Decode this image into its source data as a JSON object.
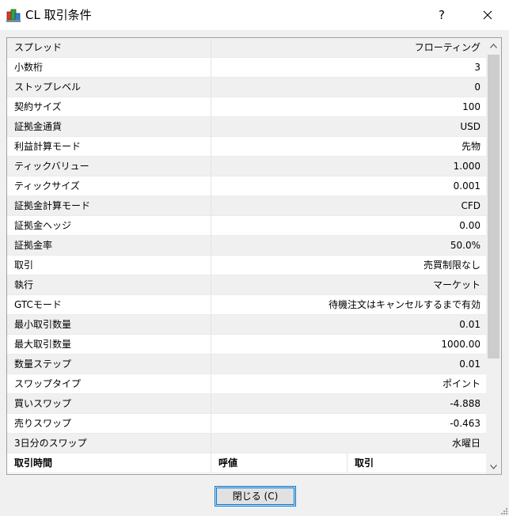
{
  "window": {
    "title": "CL 取引条件",
    "help_label": "?",
    "icon": "app-terminal-icon"
  },
  "spec_rows": [
    {
      "key": "スプレッド",
      "value": "フローティング"
    },
    {
      "key": "小数桁",
      "value": "3"
    },
    {
      "key": "ストップレベル",
      "value": "0"
    },
    {
      "key": "契約サイズ",
      "value": "100"
    },
    {
      "key": "証拠金通貨",
      "value": "USD"
    },
    {
      "key": "利益計算モード",
      "value": "先物"
    },
    {
      "key": "ティックバリュー",
      "value": "1.000"
    },
    {
      "key": "ティックサイズ",
      "value": "0.001"
    },
    {
      "key": "証拠金計算モード",
      "value": "CFD"
    },
    {
      "key": "証拠金ヘッジ",
      "value": "0.00"
    },
    {
      "key": "証拠金率",
      "value": "50.0%"
    },
    {
      "key": "取引",
      "value": "売買制限なし"
    },
    {
      "key": "執行",
      "value": "マーケット"
    },
    {
      "key": "GTCモード",
      "value": "待機注文はキャンセルするまで有効"
    },
    {
      "key": "最小取引数量",
      "value": "0.01"
    },
    {
      "key": "最大取引数量",
      "value": "1000.00"
    },
    {
      "key": "数量ステップ",
      "value": "0.01"
    },
    {
      "key": "スワップタイプ",
      "value": "ポイント"
    },
    {
      "key": "買いスワップ",
      "value": "-4.888"
    },
    {
      "key": "売りスワップ",
      "value": "-0.463"
    },
    {
      "key": "3日分のスワップ",
      "value": "水曜日"
    }
  ],
  "sessions_header": {
    "col1": "取引時間",
    "col2": "呼値",
    "col3": "取引"
  },
  "scrollbar": {
    "position_fraction": 0.0
  },
  "footer": {
    "close_label": "閉じる (C)"
  }
}
